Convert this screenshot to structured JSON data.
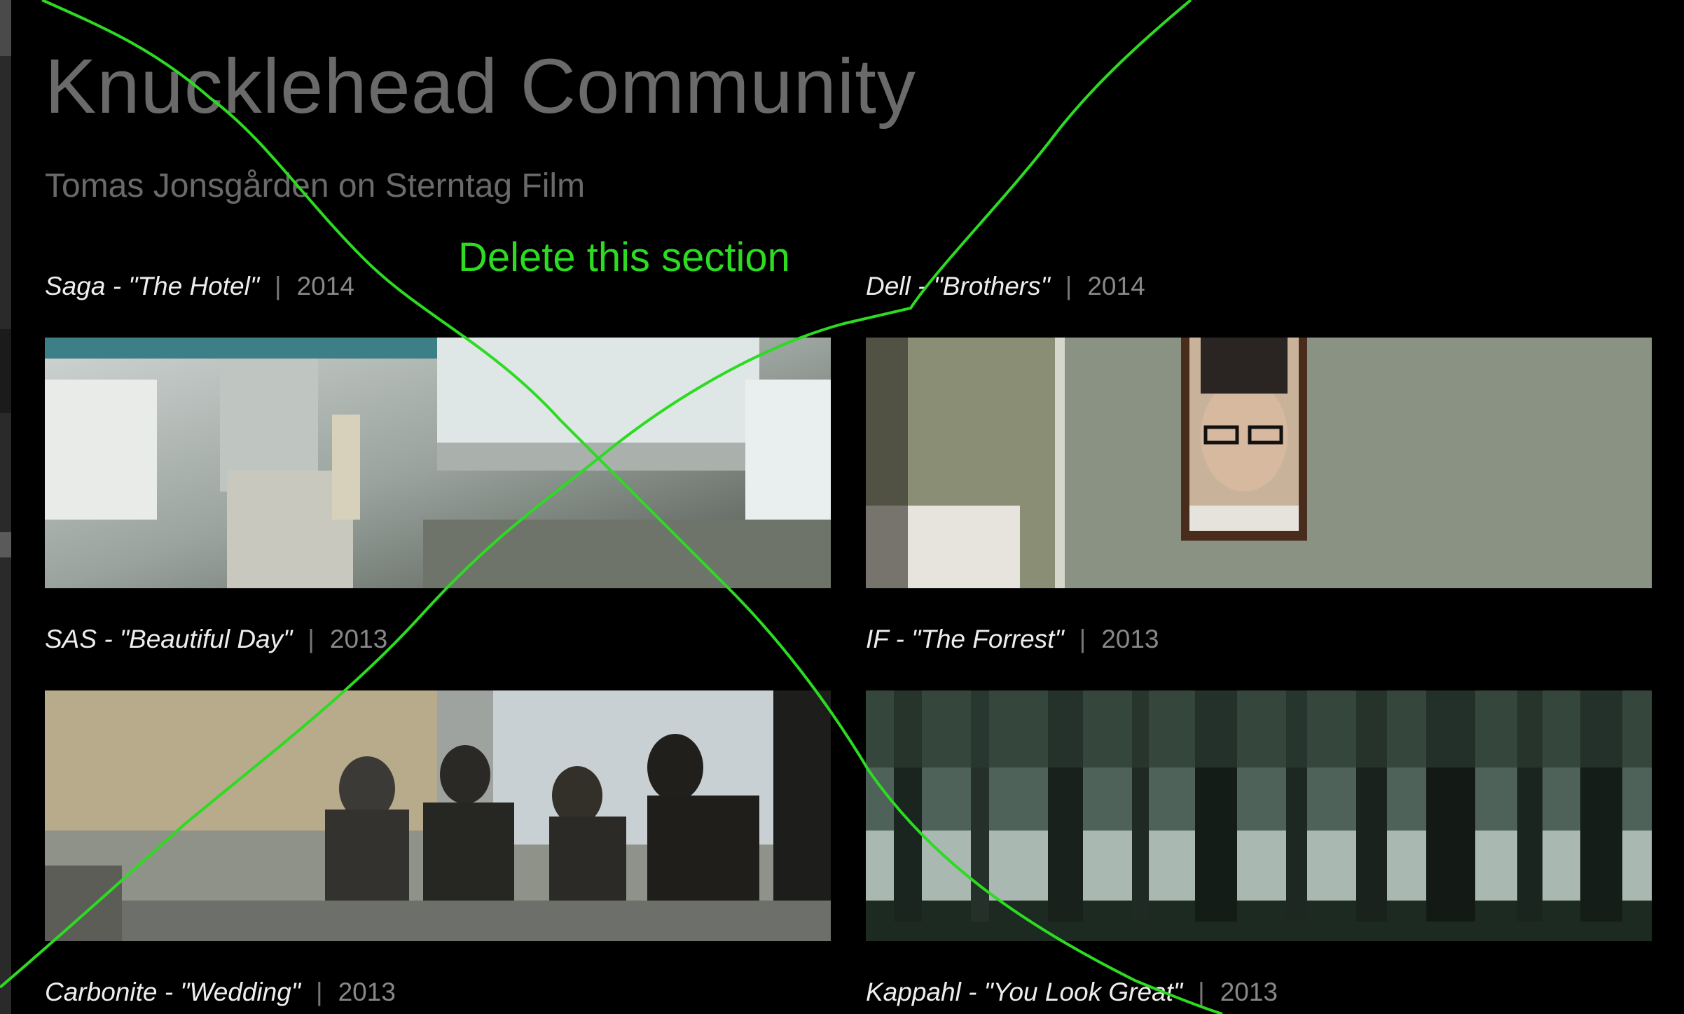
{
  "page": {
    "title": "Knucklehead Community",
    "subtitle": "Tomas Jonsgården on Sterntag Film"
  },
  "projects": [
    {
      "name": "Saga - \"The Hotel\"",
      "separator": "|",
      "year": "2014"
    },
    {
      "name": "Dell - \"Brothers\"",
      "separator": "|",
      "year": "2014"
    },
    {
      "name": "SAS - \"Beautiful Day\"",
      "separator": "|",
      "year": "2013"
    },
    {
      "name": "IF - \"The Forrest\"",
      "separator": "|",
      "year": "2013"
    },
    {
      "name": "Carbonite - \"Wedding\"",
      "separator": "|",
      "year": "2013"
    },
    {
      "name": "Kappahl - \"You Look Great\"",
      "separator": "|",
      "year": "2013"
    }
  ],
  "annotation": {
    "text": "Delete this section",
    "color": "#2cdb22"
  },
  "colors": {
    "background": "#000000",
    "title": "#6a6a6a",
    "caption": "#eeeeee",
    "year": "#888888"
  }
}
